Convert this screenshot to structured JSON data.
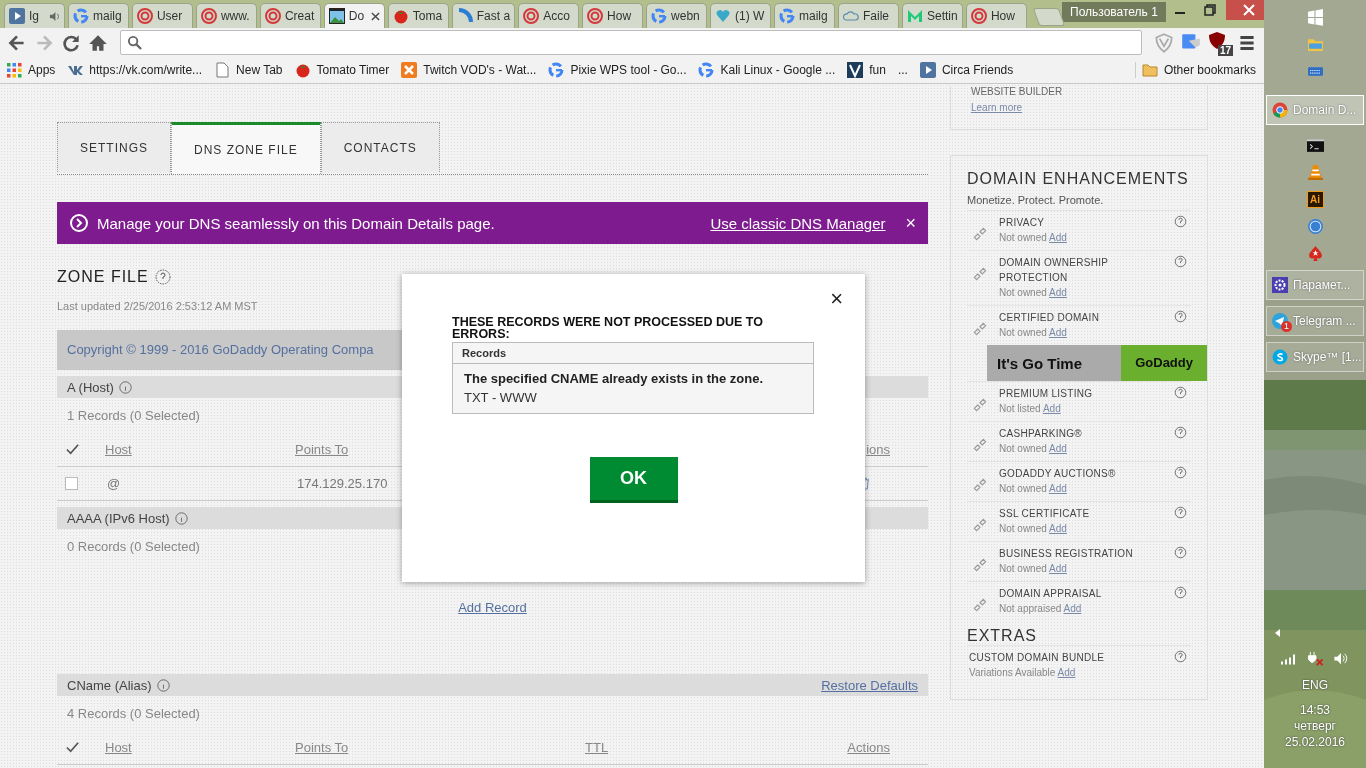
{
  "browser": {
    "tabs": [
      {
        "kind": "play",
        "title": "Ig",
        "audio": true,
        "selected": false
      },
      {
        "kind": "google",
        "title": "mailg",
        "audio": false,
        "selected": false
      },
      {
        "kind": "target",
        "title": "User",
        "audio": false,
        "selected": false
      },
      {
        "kind": "target",
        "title": "www.",
        "audio": false,
        "selected": false
      },
      {
        "kind": "target",
        "title": "Creat",
        "audio": false,
        "selected": false
      },
      {
        "kind": "picture",
        "title": "Do",
        "audio": false,
        "selected": true
      },
      {
        "kind": "tomato",
        "title": "Toma",
        "audio": false,
        "selected": false
      },
      {
        "kind": "spinner",
        "title": "Fast a",
        "audio": false,
        "selected": false
      },
      {
        "kind": "target",
        "title": "Acco",
        "audio": false,
        "selected": false
      },
      {
        "kind": "target",
        "title": "How",
        "audio": false,
        "selected": false
      },
      {
        "kind": "google",
        "title": "webn",
        "audio": false,
        "selected": false
      },
      {
        "kind": "heart",
        "title": "(1) W",
        "audio": false,
        "selected": false
      },
      {
        "kind": "google",
        "title": "mailg",
        "audio": false,
        "selected": false
      },
      {
        "kind": "cloud",
        "title": "Faile",
        "audio": false,
        "selected": false
      },
      {
        "kind": "m",
        "title": "Settin",
        "audio": false,
        "selected": false
      },
      {
        "kind": "target",
        "title": "How",
        "audio": false,
        "selected": false
      }
    ],
    "profile": "Пользователь 1",
    "forward_disabled": true,
    "extension_badge": "17",
    "bookmarks": [
      {
        "kind": "apps",
        "label": "Apps"
      },
      {
        "kind": "vk",
        "label": "https://vk.com/write..."
      },
      {
        "kind": "page",
        "label": "New Tab"
      },
      {
        "kind": "tomato",
        "label": "Tomato Timer"
      },
      {
        "kind": "xampp",
        "label": "Twitch VOD's - Wat..."
      },
      {
        "kind": "google",
        "label": "Pixie WPS tool - Go..."
      },
      {
        "kind": "google",
        "label": "Kali Linux - Google ..."
      },
      {
        "kind": "v",
        "label": "fun"
      },
      {
        "kind": "more",
        "label": "..."
      },
      {
        "kind": "play",
        "label": "Circa Friends"
      }
    ],
    "other_bookmarks": "Other bookmarks"
  },
  "page": {
    "top_card": {
      "title": "WEBSITE BUILDER",
      "link": "Learn more"
    },
    "tabs": [
      {
        "label": "SETTINGS",
        "selected": false
      },
      {
        "label": "DNS ZONE FILE",
        "selected": true
      },
      {
        "label": "CONTACTS",
        "selected": false
      }
    ],
    "banner": {
      "text": "Manage your DNS seamlessly on this Domain Details page.",
      "link": "Use classic DNS Manager",
      "close": "×"
    },
    "zone_title": "ZONE FILE",
    "last_updated": "Last updated 2/25/2016 2:53:12 AM MST",
    "footer_strip": "Copyright © 1999 - 2016 GoDaddy Operating Compa",
    "sections": [
      {
        "title": "A (Host)",
        "count": "1 Records (0 Selected)",
        "columns": [
          "Host",
          "Points To",
          "ions"
        ],
        "rows": [
          {
            "selected": false,
            "host": "@",
            "points_to": "174.129.25.170"
          }
        ]
      },
      {
        "title": "AAAA (IPv6 Host)",
        "count": "0 Records (0 Selected)",
        "add_link": "Add Record"
      },
      {
        "title": "CName (Alias)",
        "restore": "Restore Defaults",
        "count": "4 Records (0 Selected)",
        "columns": [
          "Host",
          "Points To",
          "TTL",
          "Actions"
        ]
      }
    ],
    "enhancements": {
      "title": "DOMAIN ENHANCEMENTS",
      "subtitle": "Monetize. Protect. Promote.",
      "items": [
        {
          "kind": "product",
          "name": "PRIVACY",
          "status": "Not owned",
          "action": "Add"
        },
        {
          "kind": "product",
          "name": "DOMAIN OWNERSHIP PROTECTION",
          "status": "Not owned",
          "action": "Add"
        },
        {
          "kind": "product",
          "name": "CERTIFIED DOMAIN",
          "status": "Not owned",
          "action": "Add"
        },
        {
          "kind": "promo",
          "text": "It's Go Time",
          "logo": "GoDaddy"
        },
        {
          "kind": "product",
          "name": "PREMIUM LISTING",
          "status": "Not listed",
          "action": "Add"
        },
        {
          "kind": "product",
          "name": "CASHPARKING®",
          "status": "Not owned",
          "action": "Add"
        },
        {
          "kind": "product",
          "name": "GODADDY AUCTIONS®",
          "status": "Not owned",
          "action": "Add"
        },
        {
          "kind": "product",
          "name": "SSL CERTIFICATE",
          "status": "Not owned",
          "action": "Add"
        },
        {
          "kind": "product",
          "name": "BUSINESS REGISTRATION",
          "status": "Not owned",
          "action": "Add"
        },
        {
          "kind": "product",
          "name": "DOMAIN APPRAISAL",
          "status": "Not appraised",
          "action": "Add"
        }
      ]
    },
    "extras": {
      "title": "EXTRAS",
      "items": [
        {
          "name": "CUSTOM DOMAIN BUNDLE",
          "status": "Variations Available",
          "action": "Add"
        }
      ]
    }
  },
  "dialog": {
    "close": "×",
    "title": "THESE RECORDS WERE NOT PROCESSED DUE TO ERRORS:",
    "table_header": "Records",
    "errors": [
      {
        "message": "The specified CNAME already exists in the zone.",
        "record": "TXT - WWW"
      }
    ],
    "ok": "OK"
  },
  "taskbar": {
    "items": [
      {
        "kind": "start"
      },
      {
        "kind": "explorer"
      },
      {
        "kind": "keyboard"
      },
      {
        "kind": "chrome",
        "label": "Domain D...",
        "selected": true
      },
      {
        "kind": "cmd"
      },
      {
        "kind": "vlc"
      },
      {
        "kind": "ai",
        "text": "Ai"
      },
      {
        "kind": "qbittorrent"
      },
      {
        "kind": "poker"
      },
      {
        "kind": "gear",
        "label": "Парамет...",
        "selected": false
      },
      {
        "kind": "telegram",
        "label": "Telegram ...",
        "badge": "1",
        "selected": false
      },
      {
        "kind": "skype",
        "label": "Skype™ [1...",
        "selected": false
      }
    ],
    "language": "ENG",
    "time": "14:53",
    "day": "четверг",
    "date": "25.02.2016"
  }
}
